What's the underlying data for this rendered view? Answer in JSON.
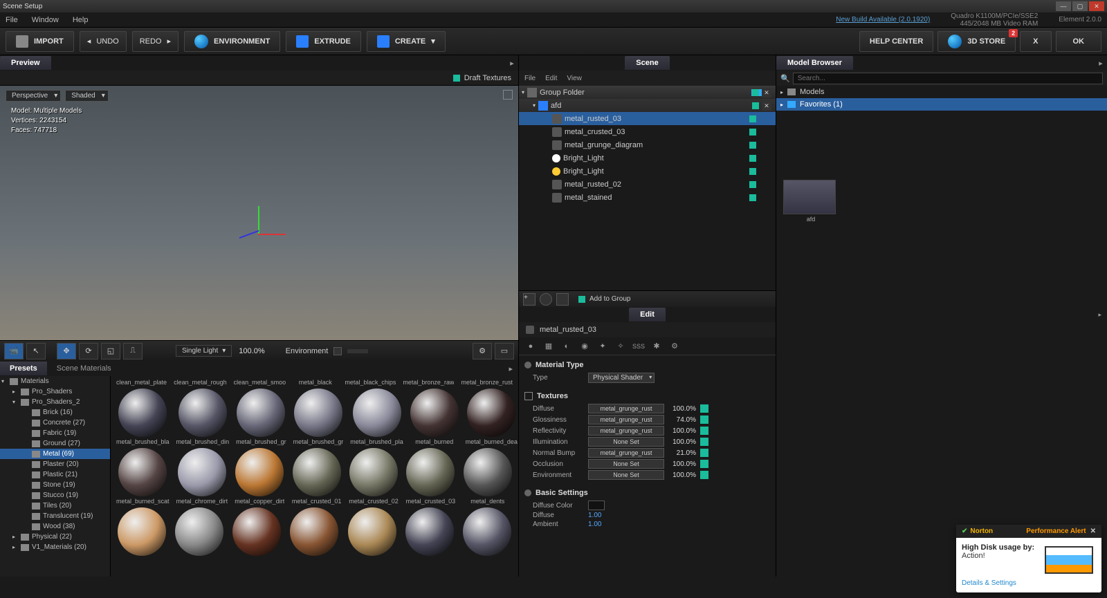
{
  "window": {
    "title": "Scene Setup"
  },
  "menubar": {
    "file": "File",
    "window": "Window",
    "help": "Help",
    "build_link": "New Build Available (2.0.1920)",
    "gpu": "Quadro K1100M/PCIe/SSE2",
    "vram": "445/2048 MB Video RAM",
    "app": "Element",
    "version": "2.0.0"
  },
  "toolbar": {
    "import": "IMPORT",
    "undo": "UNDO",
    "redo": "REDO",
    "environment": "ENVIRONMENT",
    "extrude": "EXTRUDE",
    "create": "CREATE",
    "help_center": "HELP CENTER",
    "store": "3D STORE",
    "store_badge": "2",
    "x": "X",
    "ok": "OK"
  },
  "preview": {
    "tab": "Preview",
    "draft_textures": "Draft Textures",
    "perspective": "Perspective",
    "shading": "Shaded",
    "stats": {
      "model_lbl": "Model:",
      "model": "Multiple Models",
      "verts_lbl": "Vertices:",
      "verts": "2243154",
      "faces_lbl": "Faces:",
      "faces": "747718"
    },
    "tools": {
      "light_mode": "Single Light",
      "pct": "100.0%",
      "env_lbl": "Environment"
    }
  },
  "presets": {
    "tab_presets": "Presets",
    "tab_scene_mats": "Scene Materials",
    "tree": [
      {
        "l": 1,
        "label": "Materials",
        "arrow": "▾"
      },
      {
        "l": 2,
        "label": "Pro_Shaders",
        "arrow": "▸"
      },
      {
        "l": 2,
        "label": "Pro_Shaders_2",
        "arrow": "▾"
      },
      {
        "l": 3,
        "label": "Brick (16)"
      },
      {
        "l": 3,
        "label": "Concrete (27)"
      },
      {
        "l": 3,
        "label": "Fabric (19)"
      },
      {
        "l": 3,
        "label": "Ground (27)"
      },
      {
        "l": 3,
        "label": "Metal (69)",
        "selected": true
      },
      {
        "l": 3,
        "label": "Plaster (20)"
      },
      {
        "l": 3,
        "label": "Plastic (21)"
      },
      {
        "l": 3,
        "label": "Stone (19)"
      },
      {
        "l": 3,
        "label": "Stucco (19)"
      },
      {
        "l": 3,
        "label": "Tiles (20)"
      },
      {
        "l": 3,
        "label": "Translucent (19)"
      },
      {
        "l": 3,
        "label": "Wood (38)"
      },
      {
        "l": 2,
        "label": "Physical (22)",
        "arrow": "▸"
      },
      {
        "l": 2,
        "label": "V1_Materials (20)",
        "arrow": "▸"
      }
    ],
    "grid": [
      [
        "clean_metal_plate",
        "clean_metal_rough",
        "clean_metal_smoo",
        "metal_black",
        "metal_black_chips",
        "metal_bronze_raw",
        "metal_bronze_rust"
      ],
      [
        "metal_brushed_bla",
        "metal_brushed_din",
        "metal_brushed_gr",
        "metal_brushed_gr",
        "metal_brushed_pla",
        "metal_burned",
        "metal_burned_dea"
      ],
      [
        "metal_burned_scat",
        "metal_chrome_dirt",
        "metal_copper_dirt",
        "metal_crusted_01",
        "metal_crusted_02",
        "metal_crusted_03",
        "metal_dents"
      ]
    ],
    "ball_colors": [
      [
        "#aab",
        "#889",
        "#bbc",
        "#222",
        "#333",
        "#654",
        "#765"
      ],
      [
        "#445",
        "#556",
        "#667",
        "#778",
        "#889",
        "#433",
        "#322"
      ],
      [
        "#544",
        "#99a",
        "#b73",
        "#665",
        "#776",
        "#665",
        "#555"
      ],
      [
        "#c96",
        "#888",
        "#632",
        "#853",
        "#a85",
        "#445",
        "#556"
      ]
    ]
  },
  "scene": {
    "tab": "Scene",
    "file": "File",
    "edit": "Edit",
    "view": "View",
    "group_folder": "Group Folder",
    "group_count": "1",
    "afd": "afd",
    "items": [
      {
        "name": "metal_rusted_03",
        "type": "obj",
        "selected": true
      },
      {
        "name": "metal_crusted_03",
        "type": "obj"
      },
      {
        "name": "metal_grunge_diagram",
        "type": "obj"
      },
      {
        "name": "Bright_Light",
        "type": "light",
        "color": "#fff"
      },
      {
        "name": "Bright_Light",
        "type": "light",
        "color": "#fc3"
      },
      {
        "name": "metal_rusted_02",
        "type": "obj"
      },
      {
        "name": "metal_stained",
        "type": "obj"
      }
    ],
    "add_to_group": "Add to Group"
  },
  "edit": {
    "tab": "Edit",
    "name": "metal_rusted_03",
    "mat_type_head": "Material Type",
    "type_lbl": "Type",
    "type_val": "Physical Shader",
    "textures_head": "Textures",
    "tex_rows": [
      {
        "lbl": "Diffuse",
        "val": "metal_grunge_rust",
        "pct": "100.0%"
      },
      {
        "lbl": "Glossiness",
        "val": "metal_grunge_rust",
        "pct": "74.0%"
      },
      {
        "lbl": "Reflectivity",
        "val": "metal_grunge_rust",
        "pct": "100.0%"
      },
      {
        "lbl": "Illumination",
        "val": "None Set",
        "pct": "100.0%"
      },
      {
        "lbl": "Normal Bump",
        "val": "metal_grunge_rust",
        "pct": "21.0%"
      },
      {
        "lbl": "Occlusion",
        "val": "None Set",
        "pct": "100.0%"
      },
      {
        "lbl": "Environment",
        "val": "None Set",
        "pct": "100.0%"
      }
    ],
    "basic_head": "Basic Settings",
    "diffuse_color_lbl": "Diffuse Color",
    "diffuse_lbl": "Diffuse",
    "diffuse_val": "1.00",
    "ambient_lbl": "Ambient",
    "ambient_val": "1.00"
  },
  "model_browser": {
    "tab": "Model Browser",
    "search_ph": "Search...",
    "models": "Models",
    "favorites": "Favorites (1)",
    "thumb_caption": "afd"
  },
  "norton": {
    "brand": "Norton",
    "alert": "Performance Alert",
    "headline": "High Disk usage by:",
    "process": "Action!",
    "details": "Details & Settings"
  }
}
